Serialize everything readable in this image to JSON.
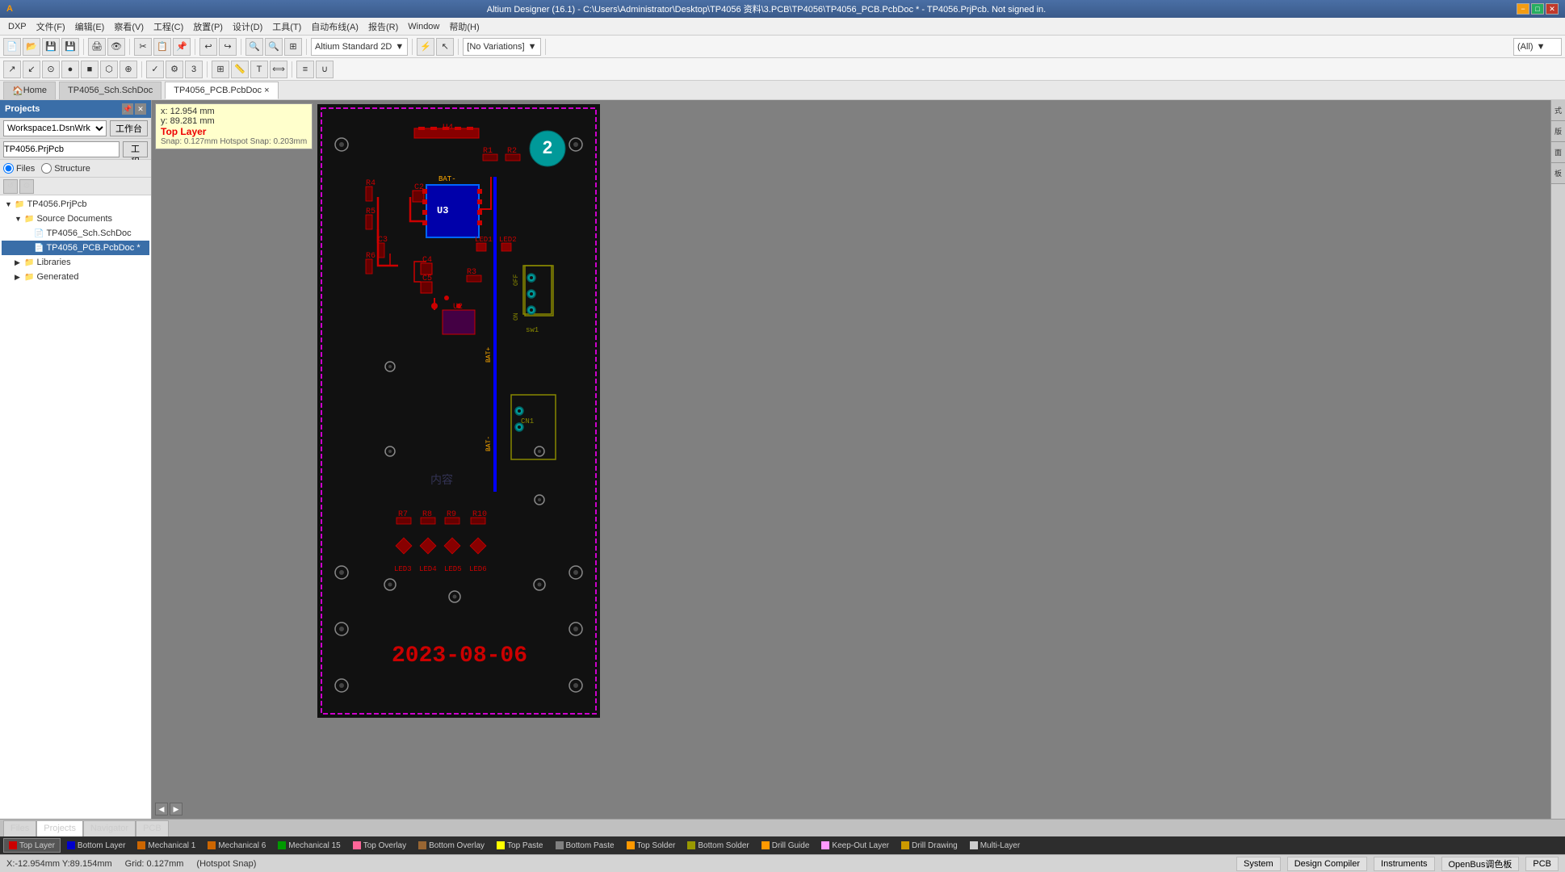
{
  "title_bar": {
    "text": "Altium Designer (16.1) - C:\\Users\\Administrator\\Desktop\\TP4056 资料\\3.PCB\\TP4056\\TP4056_PCB.PcbDoc * - TP4056.PrjPcb. Not signed in.",
    "min_label": "−",
    "max_label": "□",
    "close_label": "✕"
  },
  "menu_bar": {
    "items": [
      "DXP",
      "文件(F)",
      "编辑(E)",
      "察看(V)",
      "工程(C)",
      "放置(P)",
      "设计(D)",
      "工具(T)",
      "自动布线(A)",
      "报告(R)",
      "Window",
      "帮助(H)"
    ]
  },
  "nav_tabs": {
    "home": "Home",
    "sch_doc": "TP4056_Sch.SchDoc",
    "pcb_doc": "TP4056_PCB.PcbDoc ×"
  },
  "coord_tooltip": {
    "x": "x: 12.954 mm",
    "y": "y: 89.281 mm",
    "layer": "Top Layer",
    "snap": "Snap: 0.127mm Hotspot Snap: 0.203mm"
  },
  "panel": {
    "title": "Projects",
    "workspace_value": "Workspace1.DsnWrk",
    "workspace_btn": "工作台",
    "project_value": "TP4056.PrjPcb",
    "project_btn": "工程",
    "radio_files": "Files",
    "radio_structure": "Structure",
    "tree": {
      "root": "TP4056.PrjPcb",
      "source_documents": "Source Documents",
      "sch_doc": "TP4056_Sch.SchDoc",
      "pcb_doc": "TP4056_PCB.PcbDoc *",
      "libraries": "Libraries",
      "generated": "Generated"
    }
  },
  "toolbar": {
    "standard_2d": "Altium Standard 2D",
    "no_variations": "[No Variations]",
    "all": "(All)"
  },
  "layer_tabs": [
    {
      "color": "#cc0000",
      "label": "Top Layer",
      "active": true
    },
    {
      "color": "#0000cc",
      "label": "Bottom Layer",
      "active": false
    },
    {
      "color": "#cc6600",
      "label": "Mechanical 1",
      "active": false
    },
    {
      "color": "#cc6600",
      "label": "Mechanical 6",
      "active": false
    },
    {
      "color": "#009900",
      "label": "Mechanical 15",
      "active": false
    },
    {
      "color": "#ff6699",
      "label": "Top Overlay",
      "active": false
    },
    {
      "color": "#996633",
      "label": "Bottom Overlay",
      "active": false
    },
    {
      "color": "#ffff00",
      "label": "Top Paste",
      "active": false
    },
    {
      "color": "#808080",
      "label": "Bottom Paste",
      "active": false
    },
    {
      "color": "#ff9900",
      "label": "Top Solder",
      "active": false
    },
    {
      "color": "#999900",
      "label": "Bottom Solder",
      "active": false
    },
    {
      "color": "#ff9900",
      "label": "Drill Guide",
      "active": false
    },
    {
      "color": "#ff99ff",
      "label": "Keep-Out Layer",
      "active": false
    },
    {
      "color": "#cc9900",
      "label": "Drill Drawing",
      "active": false
    },
    {
      "color": "#cccccc",
      "label": "Multi-Layer",
      "active": false
    }
  ],
  "bottom_file_tabs": [
    {
      "label": "Files",
      "active": false
    },
    {
      "label": "Projects",
      "active": true
    },
    {
      "label": "Navigator",
      "active": false
    },
    {
      "label": "PCB",
      "active": false
    }
  ],
  "status_bar": {
    "coords": "X:-12.954mm Y:89.154mm",
    "grid": "Grid: 0.127mm",
    "snap": "(Hotspot Snap)",
    "system": "System",
    "design_compiler": "Design Compiler",
    "instruments": "Instruments",
    "openbus": "OpenBus调色板",
    "pcb": "PCB"
  },
  "right_panel_tabs": [
    "System",
    "Design Compiler",
    "Instruments",
    "OpenBus调色板",
    "PCB"
  ]
}
